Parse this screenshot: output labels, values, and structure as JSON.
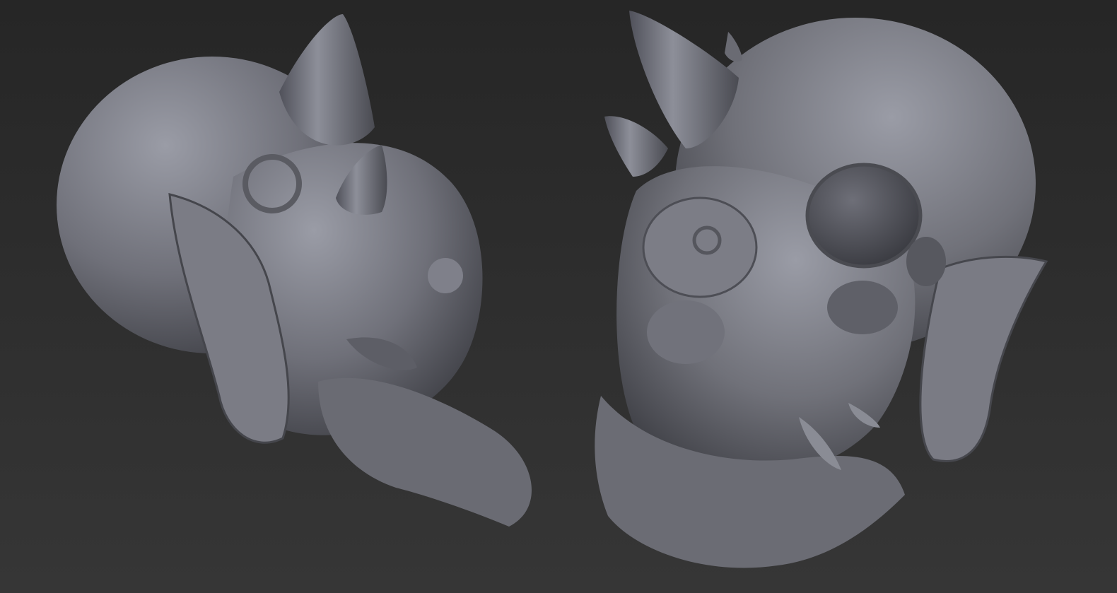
{
  "colors": {
    "background_top": "#262626",
    "background_bottom": "#363636",
    "clay_light": "#9a9ca6",
    "clay_mid": "#6f7079",
    "clay_dark": "#3c3d43"
  }
}
